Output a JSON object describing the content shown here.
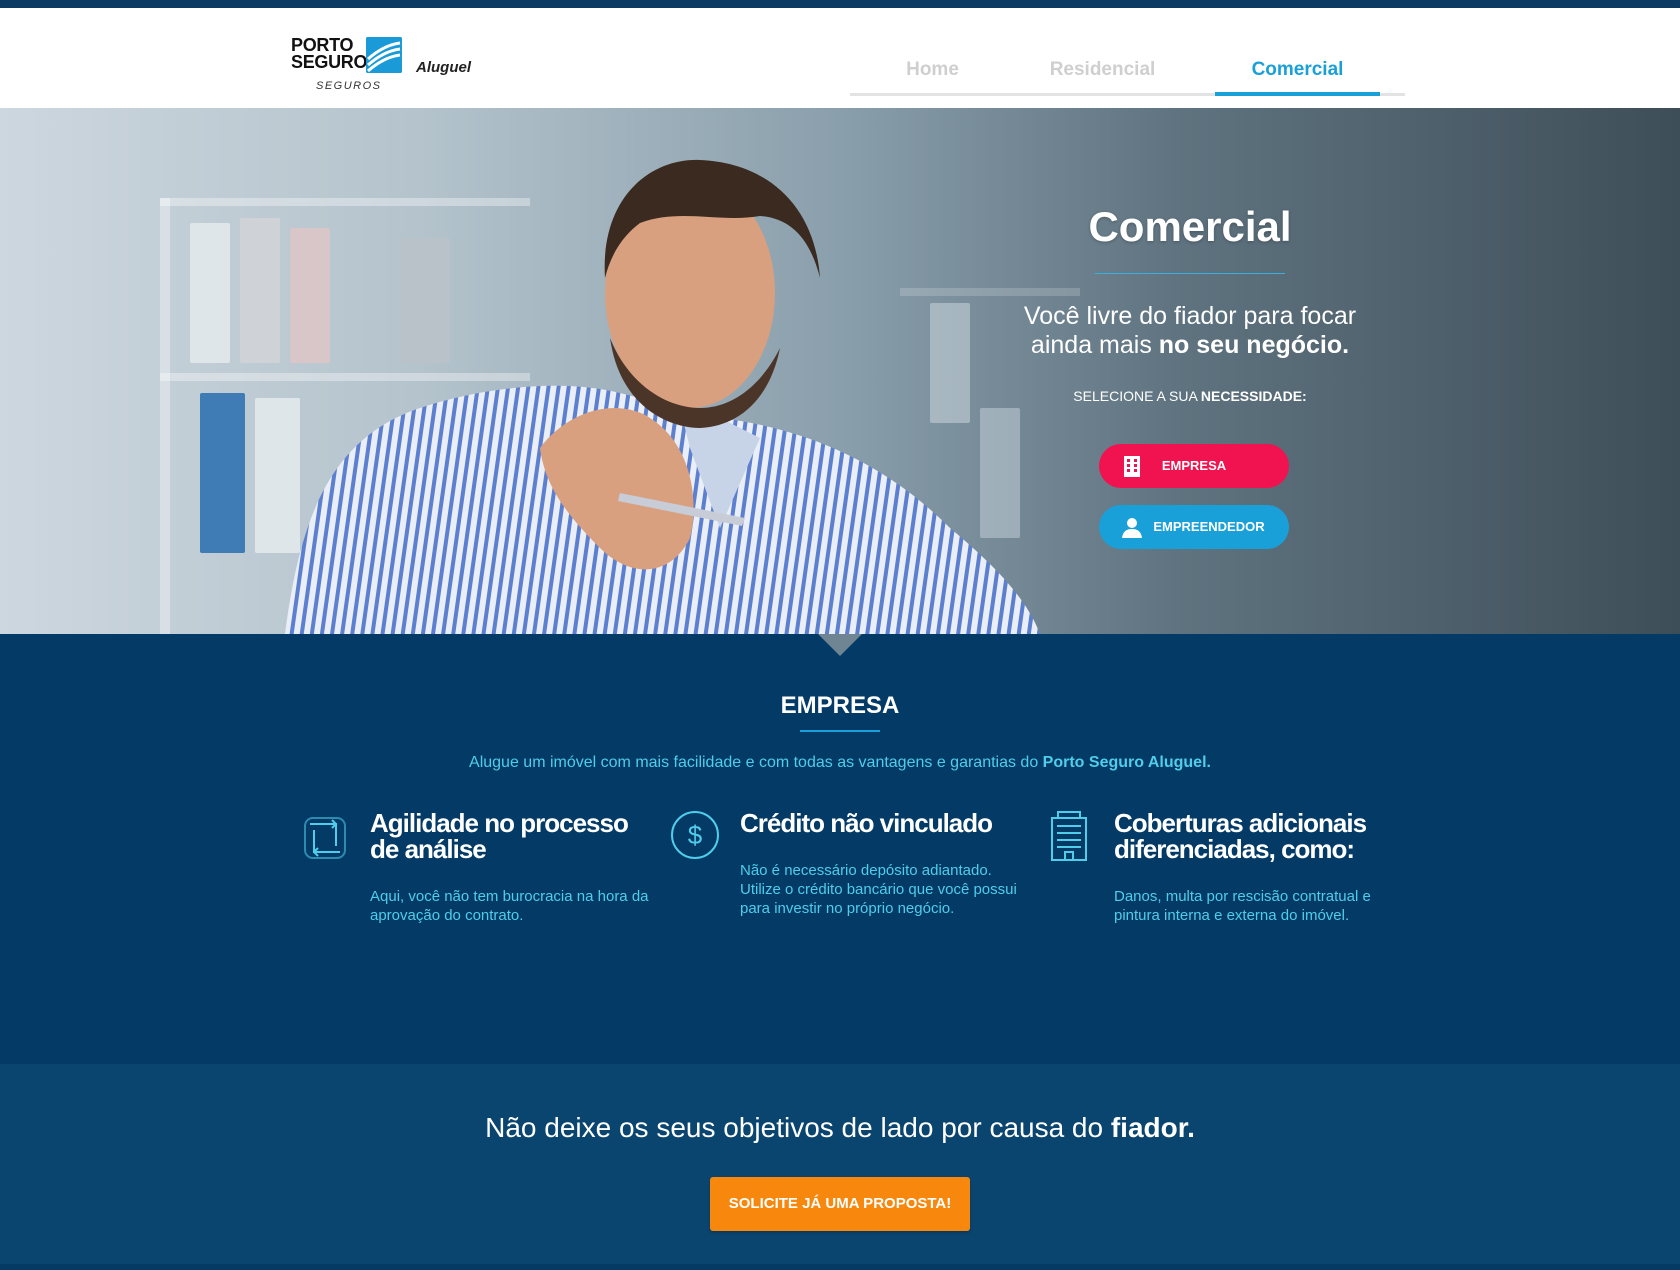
{
  "brand": {
    "porto_line1": "PORTO",
    "porto_line2": "SEGURO",
    "seguros": "SEGUROS",
    "product": "Aluguel"
  },
  "nav": {
    "tabs": [
      {
        "label": "Home",
        "active": false
      },
      {
        "label": "Residencial",
        "active": false
      },
      {
        "label": "Comercial",
        "active": true
      }
    ]
  },
  "hero": {
    "title": "Comercial",
    "lede_line1": "Você livre do fiador para focar",
    "lede_line2_plain": "ainda mais ",
    "lede_line2_bold": "no seu negócio.",
    "select_plain": "SELECIONE A SUA ",
    "select_bold": "NECESSIDADE:",
    "buttons": {
      "empresa": "EMPRESA",
      "empreendedor": "EMPREENDEDOR"
    }
  },
  "section": {
    "title": "EMPRESA",
    "lede_plain": "Alugue um imóvel com mais facilidade e com todas as vantagens e garantias do ",
    "lede_bold": "Porto Seguro Aluguel.",
    "features": [
      {
        "icon": "refresh-icon",
        "title": "Agilidade no processo de análise",
        "desc": "Aqui, você não tem burocracia na hora da aprovação do contrato."
      },
      {
        "icon": "dollar-icon",
        "title": "Crédito não vinculado",
        "desc": "Não é necessário depósito adiantado. Utilize o crédito bancário que você possui para investir no próprio negócio."
      },
      {
        "icon": "building-icon",
        "title": "Coberturas adicionais diferenciadas, como:",
        "desc": "Danos, multa por rescisão contratual e pintura interna e externa do imóvel."
      }
    ]
  },
  "cta": {
    "text_plain": "Não deixe os seus objetivos de lado por causa do ",
    "text_bold": "fiador.",
    "button": "SOLICITE JÁ UMA PROPOSTA!"
  },
  "colors": {
    "accent_blue": "#1aa0d8",
    "pink": "#f0134f",
    "orange": "#f7880d",
    "navy": "#033a66"
  }
}
